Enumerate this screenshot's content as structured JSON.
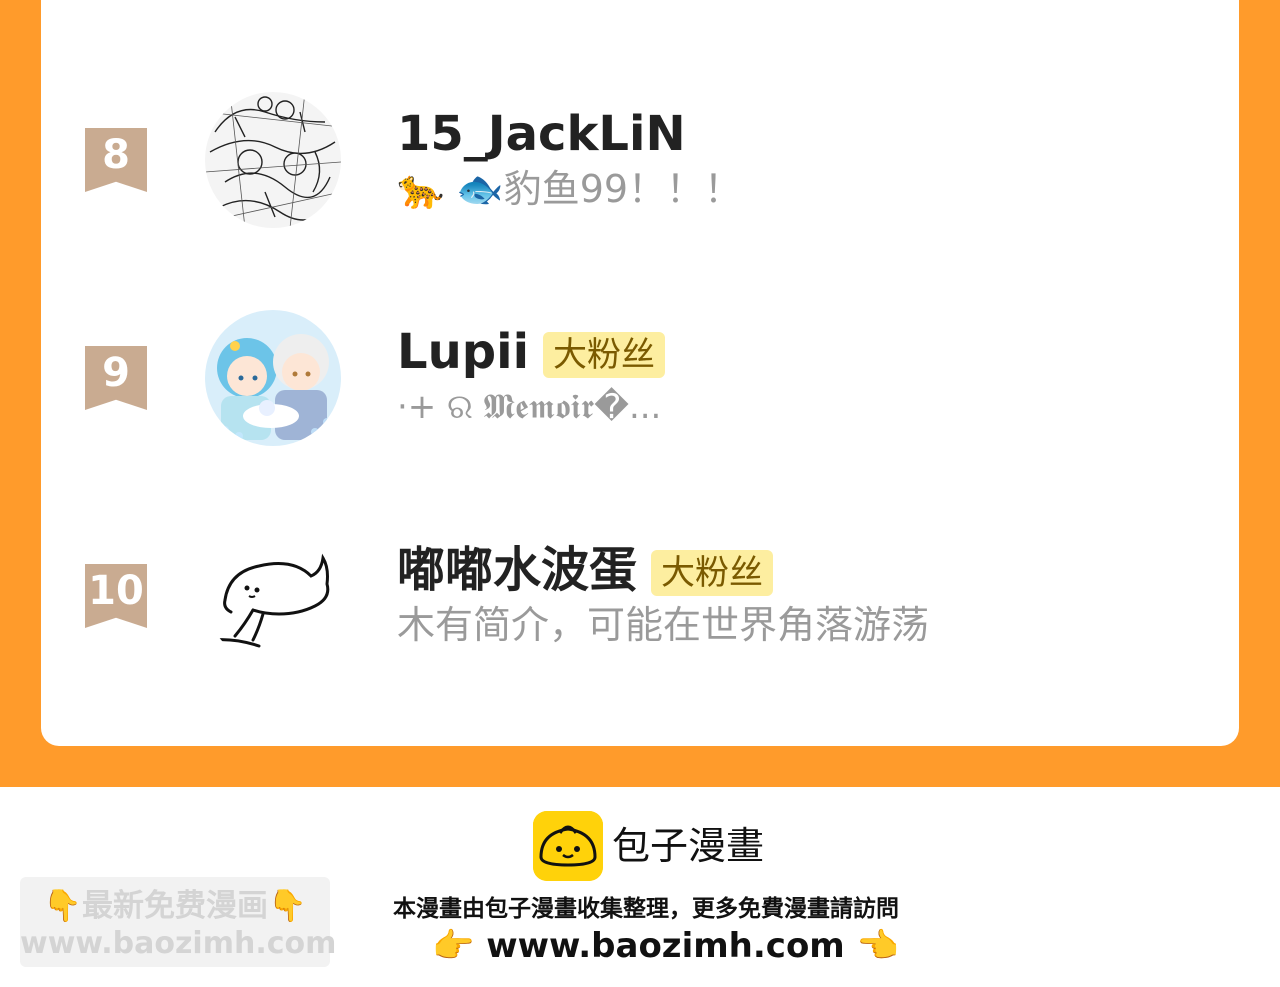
{
  "ranking": {
    "entries": [
      {
        "rank": "8",
        "username": "15_JackLiN",
        "badge": "",
        "bio": "🐆 🐟豹鱼99！！！"
      },
      {
        "rank": "9",
        "username": "Lupii",
        "badge": "大粉丝",
        "bio": "·+ ର 𝕸𝖊𝖒𝖔𝖎𝖗�..."
      },
      {
        "rank": "10",
        "username": "嘟嘟水波蛋",
        "badge": "大粉丝",
        "bio": "木有简介，可能在世界角落游荡"
      }
    ]
  },
  "footer": {
    "brand": "包子漫畫",
    "notice": "本漫畫由包子漫畫收集整理，更多免費漫畫請訪問",
    "url": "www.baozimh.com",
    "hand_left": "👉",
    "hand_right": "👈",
    "watermark": {
      "title": "👇最新免费漫画👇",
      "url": "www.baozimh.com"
    }
  },
  "colors": {
    "orange_bg": "#ff9b2b",
    "rank_ribbon": "#c9ab91",
    "badge_bg": "#fdeea0",
    "logo_yellow": "#ffd20a"
  }
}
